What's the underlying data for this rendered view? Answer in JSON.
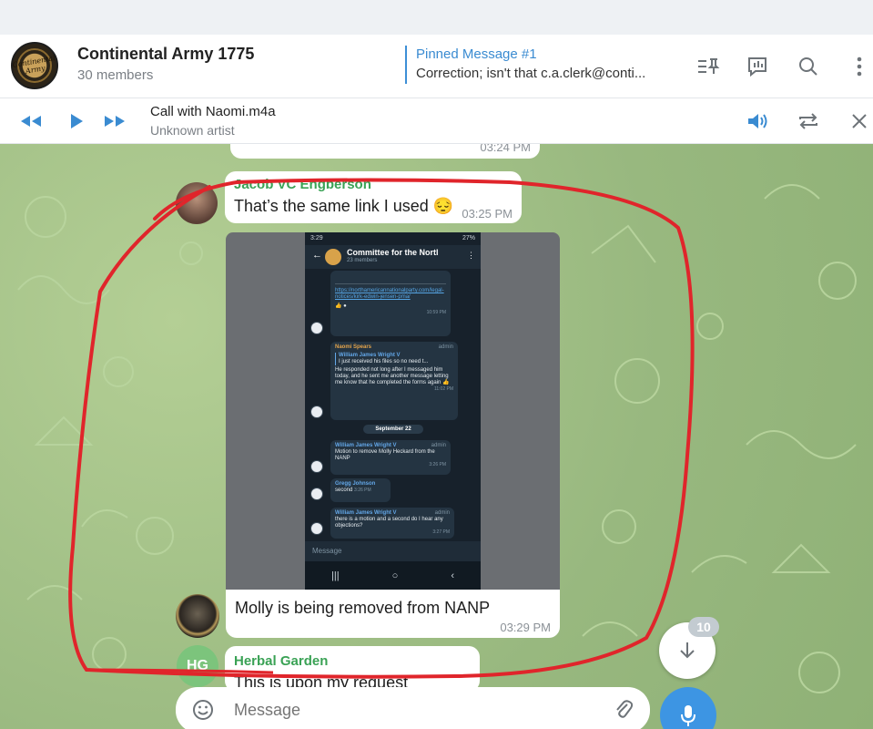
{
  "header": {
    "group_avatar_text": "Continental Army",
    "title": "Continental Army 1775",
    "members": "30 members",
    "pinned_title": "Pinned Message #1",
    "pinned_text": "Correction; isn't that c.a.clerk@conti...",
    "icons": [
      "pinned-list-icon",
      "poll-icon",
      "search-icon",
      "more-vert-icon"
    ]
  },
  "player": {
    "title": "Call with Naomi.m4a",
    "artist": "Unknown artist",
    "icons": [
      "rewind-icon",
      "play-icon",
      "fast-forward-icon",
      "volume-icon",
      "repeat-icon",
      "close-icon"
    ]
  },
  "chat": {
    "prev_time": "03:24 PM",
    "msg1": {
      "sender": "Jacob VC Engberson",
      "text": "That’s the same link I used 😔",
      "time": "03:25 PM"
    },
    "msg2": {
      "caption": "Molly is being removed from NANP",
      "time": "03:29 PM"
    },
    "msg3": {
      "avatar_initials": "HG",
      "sender": "Herbal Garden",
      "text": "This is upon my request"
    },
    "unread_count": "10",
    "input_placeholder": "Message"
  },
  "screenshot": {
    "status_time": "3:29",
    "status_right": "27%",
    "title": "Committee for the Nortl",
    "members": "23 members",
    "link": "https://northamericannationalparty.com/legal-notices/kirk-edwin-jensen-pma/",
    "link_time": "10:59 PM",
    "naomi_name": "Naomi Spears",
    "naomi_role": "admin",
    "naomi_reply_name": "William James Wright V",
    "naomi_reply_text": "I just received his files so no need t...",
    "naomi_text": "He responded not long after I messaged him today, and he sent me another message letting me know that he completed the forms again 👍",
    "naomi_time": "11:02 PM",
    "date": "September 22",
    "w1_name": "William James Wright V",
    "w1_role": "admin",
    "w1_text": "Motion to remove Molly Heckard from the NANP",
    "w1_time": "3:26 PM",
    "g_name": "Gregg Johnson",
    "g_text": "second",
    "g_time": "3:26 PM",
    "w2_name": "William James Wright V",
    "w2_role": "admin",
    "w2_text": "there is a motion and a second do I hear any objections?",
    "w2_time": "3:27 PM",
    "input_placeholder": "Message"
  }
}
